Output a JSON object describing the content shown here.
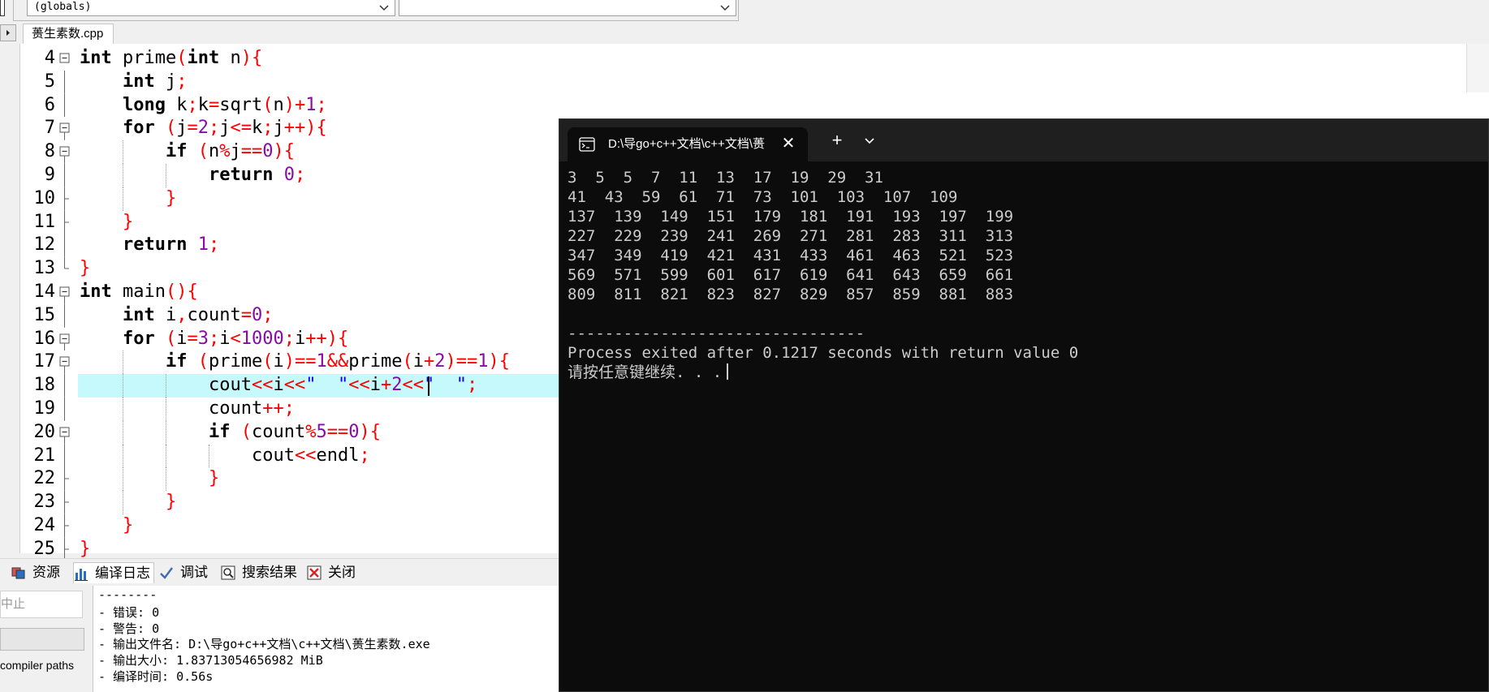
{
  "toolbar": {
    "scope_combo": "(globals)",
    "member_combo": ""
  },
  "file_tab": {
    "label": "蒉生素数.cpp"
  },
  "editor": {
    "lines": [
      {
        "n": "4",
        "fold": "minus",
        "indent": 0,
        "tokens": [
          [
            "kw",
            "int"
          ],
          [
            "",
            "prime"
          ],
          [
            "sym",
            "("
          ],
          [
            "kw",
            "int"
          ],
          [
            "",
            "n"
          ],
          [
            "sym",
            "){"
          ]
        ]
      },
      {
        "n": "5",
        "fold": "bar",
        "indent": 1,
        "tokens": [
          [
            "kw",
            "int"
          ],
          [
            "",
            "j"
          ],
          [
            "sym",
            ";"
          ]
        ]
      },
      {
        "n": "6",
        "fold": "bar",
        "indent": 1,
        "tokens": [
          [
            "kw",
            "long"
          ],
          [
            "",
            "k"
          ],
          [
            "sym",
            ";"
          ],
          [
            "",
            "k"
          ],
          [
            "sym",
            "="
          ],
          [
            "",
            "sqrt"
          ],
          [
            "sym",
            "("
          ],
          [
            "",
            "n"
          ],
          [
            "sym",
            ")+"
          ],
          [
            "num",
            "1"
          ],
          [
            "sym",
            ";"
          ]
        ]
      },
      {
        "n": "7",
        "fold": "minus",
        "indent": 1,
        "tokens": [
          [
            "kw",
            "for"
          ],
          [
            "sym",
            "("
          ],
          [
            "",
            "j"
          ],
          [
            "sym",
            "="
          ],
          [
            "num",
            "2"
          ],
          [
            "sym",
            ";"
          ],
          [
            "",
            "j"
          ],
          [
            "sym",
            "<="
          ],
          [
            "",
            "k"
          ],
          [
            "sym",
            ";"
          ],
          [
            "",
            "j"
          ],
          [
            "sym",
            "++){"
          ]
        ]
      },
      {
        "n": "8",
        "fold": "minus",
        "indent": 2,
        "tokens": [
          [
            "kw",
            "if"
          ],
          [
            "sym",
            "("
          ],
          [
            "",
            "n"
          ],
          [
            "sym",
            "%"
          ],
          [
            "",
            "j"
          ],
          [
            "sym",
            "=="
          ],
          [
            "num",
            "0"
          ],
          [
            "sym",
            "){"
          ]
        ]
      },
      {
        "n": "9",
        "fold": "bar",
        "indent": 3,
        "tokens": [
          [
            "kw",
            "return"
          ],
          [
            "num",
            "0"
          ],
          [
            "sym",
            ";"
          ]
        ]
      },
      {
        "n": "10",
        "fold": "end",
        "indent": 2,
        "tokens": [
          [
            "sym",
            "}"
          ]
        ]
      },
      {
        "n": "11",
        "fold": "end",
        "indent": 1,
        "tokens": [
          [
            "sym",
            "}"
          ]
        ]
      },
      {
        "n": "12",
        "fold": "bar",
        "indent": 1,
        "tokens": [
          [
            "kw",
            "return"
          ],
          [
            "num",
            "1"
          ],
          [
            "sym",
            ";"
          ]
        ]
      },
      {
        "n": "13",
        "fold": "endfinal",
        "indent": 0,
        "tokens": [
          [
            "sym",
            "}"
          ]
        ]
      },
      {
        "n": "14",
        "fold": "minus",
        "indent": 0,
        "tokens": [
          [
            "kw",
            "int"
          ],
          [
            "",
            "main"
          ],
          [
            "sym",
            "(){"
          ]
        ]
      },
      {
        "n": "15",
        "fold": "bar",
        "indent": 1,
        "tokens": [
          [
            "kw",
            "int"
          ],
          [
            "",
            "i"
          ],
          [
            "sym",
            ","
          ],
          [
            "",
            "count"
          ],
          [
            "sym",
            "="
          ],
          [
            "num",
            "0"
          ],
          [
            "sym",
            ";"
          ]
        ]
      },
      {
        "n": "16",
        "fold": "minus",
        "indent": 1,
        "tokens": [
          [
            "kw",
            "for"
          ],
          [
            "sym",
            "("
          ],
          [
            "",
            "i"
          ],
          [
            "sym",
            "="
          ],
          [
            "num",
            "3"
          ],
          [
            "sym",
            ";"
          ],
          [
            "",
            "i"
          ],
          [
            "sym",
            "<"
          ],
          [
            "num",
            "1000"
          ],
          [
            "sym",
            ";"
          ],
          [
            "",
            "i"
          ],
          [
            "sym",
            "++){"
          ]
        ]
      },
      {
        "n": "17",
        "fold": "minus",
        "indent": 2,
        "tokens": [
          [
            "kw",
            "if"
          ],
          [
            "sym",
            "("
          ],
          [
            "",
            "prime"
          ],
          [
            "sym",
            "("
          ],
          [
            "",
            "i"
          ],
          [
            "sym",
            ")=="
          ],
          [
            "num",
            "1"
          ],
          [
            "sym",
            "&&"
          ],
          [
            "",
            "prime"
          ],
          [
            "sym",
            "("
          ],
          [
            "",
            "i"
          ],
          [
            "sym",
            "+"
          ],
          [
            "num",
            "2"
          ],
          [
            "sym",
            ")=="
          ],
          [
            "num",
            "1"
          ],
          [
            "sym",
            "){"
          ]
        ]
      },
      {
        "n": "18",
        "fold": "bar",
        "indent": 3,
        "hl": true,
        "tokens": [
          [
            "",
            "cout"
          ],
          [
            "sym",
            "<<"
          ],
          [
            "",
            "i"
          ],
          [
            "sym",
            "<<"
          ],
          [
            "str",
            "\"  \""
          ],
          [
            "sym",
            "<<"
          ],
          [
            "",
            "i"
          ],
          [
            "sym",
            "+"
          ],
          [
            "num",
            "2"
          ],
          [
            "sym",
            "<<"
          ],
          [
            "str",
            "\"  \""
          ],
          [
            "sym",
            ";"
          ]
        ]
      },
      {
        "n": "19",
        "fold": "bar",
        "indent": 3,
        "tokens": [
          [
            "",
            "count"
          ],
          [
            "sym",
            "++;"
          ]
        ]
      },
      {
        "n": "20",
        "fold": "minus",
        "indent": 3,
        "tokens": [
          [
            "kw",
            "if"
          ],
          [
            "sym",
            "("
          ],
          [
            "",
            "count"
          ],
          [
            "sym",
            "%"
          ],
          [
            "num",
            "5"
          ],
          [
            "sym",
            "=="
          ],
          [
            "num",
            "0"
          ],
          [
            "sym",
            "){"
          ]
        ]
      },
      {
        "n": "21",
        "fold": "bar",
        "indent": 4,
        "tokens": [
          [
            "",
            "cout"
          ],
          [
            "sym",
            "<<"
          ],
          [
            "",
            "endl"
          ],
          [
            "sym",
            ";"
          ]
        ]
      },
      {
        "n": "22",
        "fold": "end",
        "indent": 3,
        "tokens": [
          [
            "sym",
            "}"
          ]
        ]
      },
      {
        "n": "23",
        "fold": "end",
        "indent": 2,
        "tokens": [
          [
            "sym",
            "}"
          ]
        ]
      },
      {
        "n": "24",
        "fold": "end",
        "indent": 1,
        "tokens": [
          [
            "sym",
            "}"
          ]
        ]
      },
      {
        "n": "25",
        "fold": "end",
        "indent": 0,
        "tokens": [
          [
            "sym",
            "}"
          ]
        ]
      }
    ]
  },
  "bottom_tabs": [
    {
      "label": "资源",
      "icon": "resources-icon",
      "active": false
    },
    {
      "label": "编译日志",
      "icon": "bar-chart-icon",
      "active": true
    },
    {
      "label": "调试",
      "icon": "check-icon",
      "active": false
    },
    {
      "label": "搜索结果",
      "icon": "search-results-icon",
      "active": false
    },
    {
      "label": "关闭",
      "icon": "close-icon",
      "active": false
    }
  ],
  "bottom_left": {
    "abort_label": "中止",
    "compiler_paths": "compiler paths"
  },
  "log": {
    "lines": [
      "--------",
      "- 错误: 0",
      "- 警告: 0",
      "- 输出文件名: D:\\导go+c++文档\\c++文档\\蒉生素数.exe",
      "- 输出大小: 1.83713054656982 MiB",
      "- 编译时间: 0.56s"
    ]
  },
  "terminal": {
    "title": "D:\\导go+c++文档\\c++文档\\蒉",
    "output": [
      "3  5  5  7  11  13  17  19  29  31",
      "41  43  59  61  71  73  101  103  107  109",
      "137  139  149  151  179  181  191  193  197  199",
      "227  229  239  241  269  271  281  283  311  313",
      "347  349  419  421  431  433  461  463  521  523",
      "569  571  599  601  617  619  641  643  659  661",
      "809  811  821  823  827  829  857  859  881  883",
      "",
      "--------------------------------",
      "Process exited after 0.1217 seconds with return value 0",
      "请按任意键继续. . ."
    ]
  }
}
